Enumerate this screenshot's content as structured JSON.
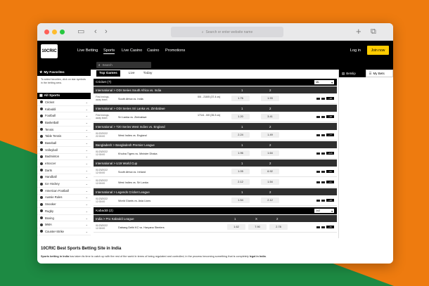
{
  "browser": {
    "url_placeholder": "Search or enter website name",
    "colors": {
      "close": "#ff5f57",
      "min": "#febc2e",
      "max": "#28c840"
    }
  },
  "nav": {
    "logo": "10CRIC",
    "links": [
      "Live Betting",
      "Sports",
      "Live Casino",
      "Casino",
      "Promotions"
    ],
    "login": "Log in",
    "join": "Join now"
  },
  "search": {
    "placeholder": "Search"
  },
  "sidebar": {
    "favorites_title": "My Favorites",
    "favorites_text": "To select favorites, click on star symbols in the betting area.",
    "all_sports_title": "All Sports",
    "sports": [
      "Cricket",
      "Kabaddi",
      "Football",
      "Basketball",
      "Tennis",
      "Table Tennis",
      "Baseball",
      "Volleyball",
      "Badminton",
      "eSoccer",
      "Darts",
      "Handball",
      "Ice Hockey",
      "American Football",
      "Aussie Rules",
      "Snooker",
      "Rugby",
      "Boxing",
      "MMA",
      "Counter-Strike"
    ]
  },
  "main": {
    "tabs": [
      "Top Games",
      "Live",
      "Today"
    ],
    "cricket_section": {
      "title": "Cricket (7)",
      "select": "ML"
    },
    "kabaddi_section": {
      "title": "Kabaddi (2)",
      "select": "1x2"
    },
    "leagues": [
      {
        "name": "International > ODI Series South Africa vs. India",
        "cols": [
          "1",
          "2"
        ],
        "rows": [
          {
            "time": "First Innings, away team",
            "teams": "South Africa vs. India",
            "score": "0/0 - 210/5 (37.4 ov)",
            "odds": [
              "1.76",
              "1.93"
            ],
            "badge": "+38"
          }
        ]
      },
      {
        "name": "International > ODI Series Sri Lanka vs. Zimbabwe",
        "cols": [
          "1",
          "2"
        ],
        "rows": [
          {
            "time": "First Innings, away team",
            "teams": "Sri Lanka vs. Zimbabwe",
            "score": "171/4 - 0/0 (35.3 ov)",
            "odds": [
              "1.20",
              "3.41"
            ],
            "badge": "+38"
          }
        ]
      },
      {
        "name": "International > T20 Series West Indies vs. England",
        "cols": [
          "1",
          "2"
        ],
        "rows": [
          {
            "time": "01/22/2022 22:00:00",
            "teams": "West Indies vs. England",
            "score": "",
            "odds": [
              "2.24",
              "1.49"
            ],
            "badge": "+77"
          }
        ]
      },
      {
        "name": "Bangladesh > Bangladesh Premier League",
        "cols": [
          "1",
          "2"
        ],
        "rows": [
          {
            "time": "01/23/2022 12:30:00",
            "teams": "Khulna Tigers vs. Minister Dhaka",
            "score": "",
            "odds": [
              "1.96",
              "1.64"
            ],
            "badge": "+126"
          }
        ]
      },
      {
        "name": "International > U19 World Cup",
        "cols": [
          "1",
          "2"
        ],
        "rows": [
          {
            "time": "01/23/2022 12:00:00",
            "teams": "South Africa vs. Ireland",
            "score": "",
            "odds": [
              "1.05",
              "6.92"
            ],
            "badge": "+11"
          },
          {
            "time": "01/23/2022 12:00:00",
            "teams": "West Indies vs. Sri Lanka",
            "score": "",
            "odds": [
              "2.12",
              "1.54"
            ],
            "badge": "+11"
          }
        ]
      },
      {
        "name": "International > Legends Cricket League",
        "cols": [
          "1",
          "2"
        ],
        "rows": [
          {
            "time": "01/23/2022 12:30:00",
            "teams": "World Giants vs. Asia Lions",
            "score": "",
            "odds": [
              "1.54",
              "2.12"
            ],
            "badge": "+28"
          }
        ]
      }
    ],
    "kabaddi_leagues": [
      {
        "name": "India > Pro Kabaddi League",
        "cols": [
          "1",
          "X",
          "2"
        ],
        "rows": [
          {
            "time": "01/23/2022 12:30:00",
            "teams": "Dabang Delhi KC vs. Haryana Steelers",
            "score": "",
            "odds": [
              "1.62",
              "7.90",
              "2.78"
            ],
            "badge": "+56"
          }
        ]
      }
    ]
  },
  "betslip": {
    "tab1": "Betslip",
    "tab2": "My Bets"
  },
  "article": {
    "title": "10CRIC Best Sports Betting Site in India",
    "text_bold_1": "Sports betting in India",
    "text_mid": " has taken its time to catch up with the rest of the world in terms of being regulated and controlled, in the process becoming something that is completely ",
    "text_bold_2": "legal in India",
    "text_end": "."
  }
}
